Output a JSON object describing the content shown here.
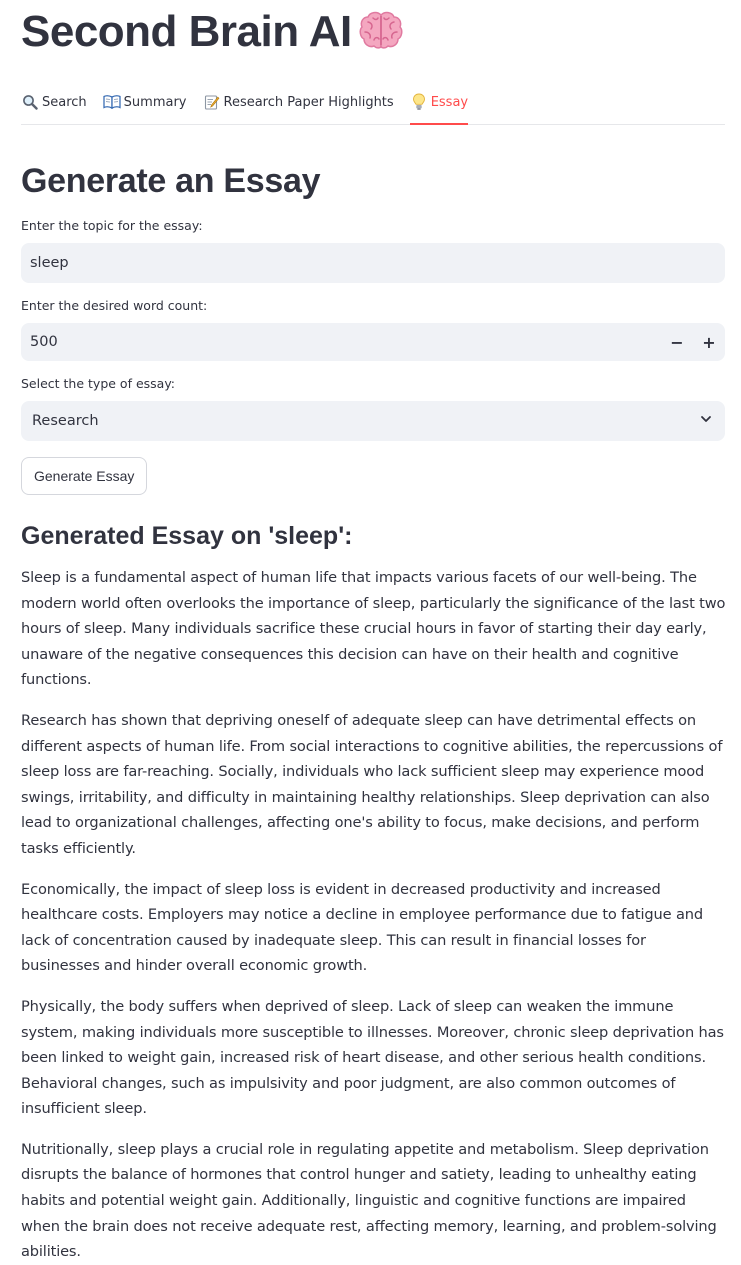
{
  "app": {
    "title": "Second Brain AI",
    "title_icon": "brain-icon"
  },
  "tabs": [
    {
      "label": "Search",
      "icon": "magnifier-icon",
      "active": false
    },
    {
      "label": "Summary",
      "icon": "open-book-icon",
      "active": false
    },
    {
      "label": "Research Paper Highlights",
      "icon": "memo-icon",
      "active": false
    },
    {
      "label": "Essay",
      "icon": "lightbulb-icon",
      "active": true
    }
  ],
  "colors": {
    "accent": "#ff4b4b",
    "text": "#31333f",
    "input_bg": "#f0f2f6"
  },
  "form": {
    "title": "Generate an Essay",
    "topic_label": "Enter the topic for the essay:",
    "topic_value": "sleep",
    "word_count_label": "Enter the desired word count:",
    "word_count_value": "500",
    "minus_label": "−",
    "plus_label": "+",
    "type_label": "Select the type of essay:",
    "type_value": "Research",
    "generate_label": "Generate Essay"
  },
  "result": {
    "heading": "Generated Essay on 'sleep':",
    "paragraphs": [
      "Sleep is a fundamental aspect of human life that impacts various facets of our well-being. The modern world often overlooks the importance of sleep, particularly the significance of the last two hours of sleep. Many individuals sacrifice these crucial hours in favor of starting their day early, unaware of the negative consequences this decision can have on their health and cognitive functions.",
      "Research has shown that depriving oneself of adequate sleep can have detrimental effects on different aspects of human life. From social interactions to cognitive abilities, the repercussions of sleep loss are far-reaching. Socially, individuals who lack sufficient sleep may experience mood swings, irritability, and difficulty in maintaining healthy relationships. Sleep deprivation can also lead to organizational challenges, affecting one's ability to focus, make decisions, and perform tasks efficiently.",
      "Economically, the impact of sleep loss is evident in decreased productivity and increased healthcare costs. Employers may notice a decline in employee performance due to fatigue and lack of concentration caused by inadequate sleep. This can result in financial losses for businesses and hinder overall economic growth.",
      "Physically, the body suffers when deprived of sleep. Lack of sleep can weaken the immune system, making individuals more susceptible to illnesses. Moreover, chronic sleep deprivation has been linked to weight gain, increased risk of heart disease, and other serious health conditions. Behavioral changes, such as impulsivity and poor judgment, are also common outcomes of insufficient sleep.",
      "Nutritionally, sleep plays a crucial role in regulating appetite and metabolism. Sleep deprivation disrupts the balance of hormones that control hunger and satiety, leading to unhealthy eating habits and potential weight gain. Additionally, linguistic and cognitive functions are impaired when the brain does not receive adequate rest, affecting memory, learning, and problem-solving abilities."
    ]
  }
}
